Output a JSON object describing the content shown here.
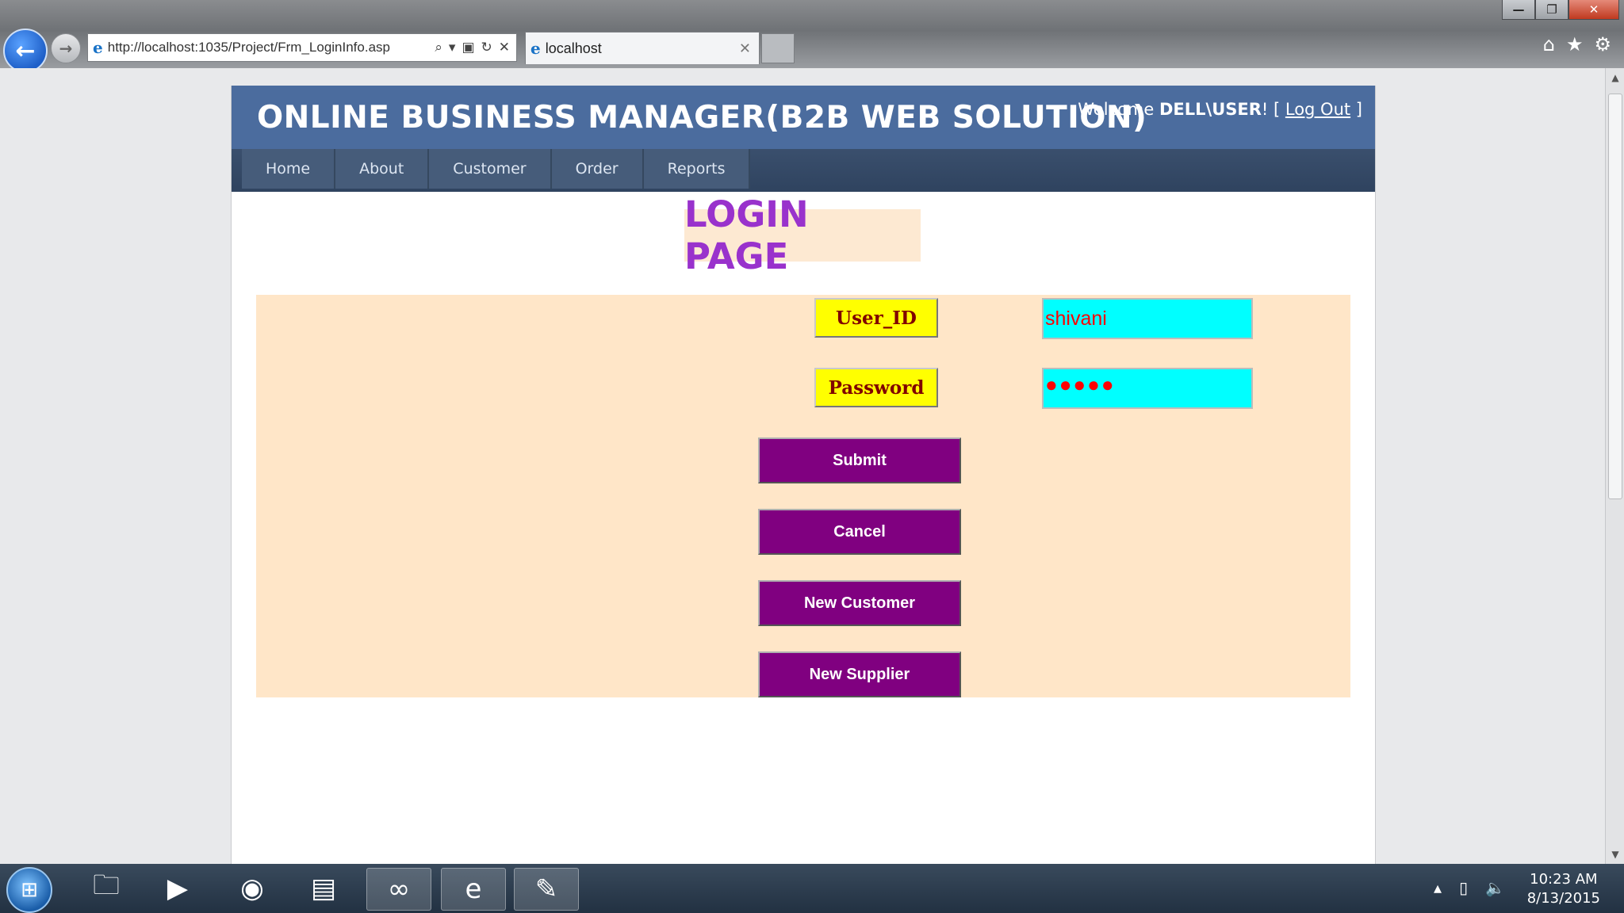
{
  "browser": {
    "address": "http://localhost:1035/Project/Frm_LoginInfo.asp",
    "tab_title": "localhost",
    "window_buttons": {
      "minimize": "—",
      "restore": "❐",
      "close": "✕"
    }
  },
  "site": {
    "title": "ONLINE BUSINESS MANAGER(B2B WEB SOLUTION)",
    "welcome_prefix": "Welcome ",
    "username": "DELL\\USER",
    "welcome_suffix": "! [ ",
    "logout": "Log Out",
    "welcome_end": " ]"
  },
  "menu": {
    "items": [
      {
        "label": "Home"
      },
      {
        "label": "About"
      },
      {
        "label": "Customer"
      },
      {
        "label": "Order"
      },
      {
        "label": "Reports"
      }
    ]
  },
  "login": {
    "heading": "LOGIN PAGE",
    "user_label": "User_ID",
    "user_value": "shivani",
    "password_label": "Password",
    "password_value": "●●●●●",
    "submit": "Submit",
    "cancel": "Cancel",
    "new_customer": "New Customer",
    "new_supplier": "New Supplier"
  },
  "taskbar": {
    "time": "10:23 AM",
    "date": "8/13/2015"
  },
  "colors": {
    "header": "#4b6c9e",
    "menu": "#3a4f6d",
    "heading_text": "#9932cc",
    "panel": "#ffe6c8",
    "label_bg": "#ffff00",
    "input_bg": "#00ffff",
    "button_bg": "#800080"
  }
}
